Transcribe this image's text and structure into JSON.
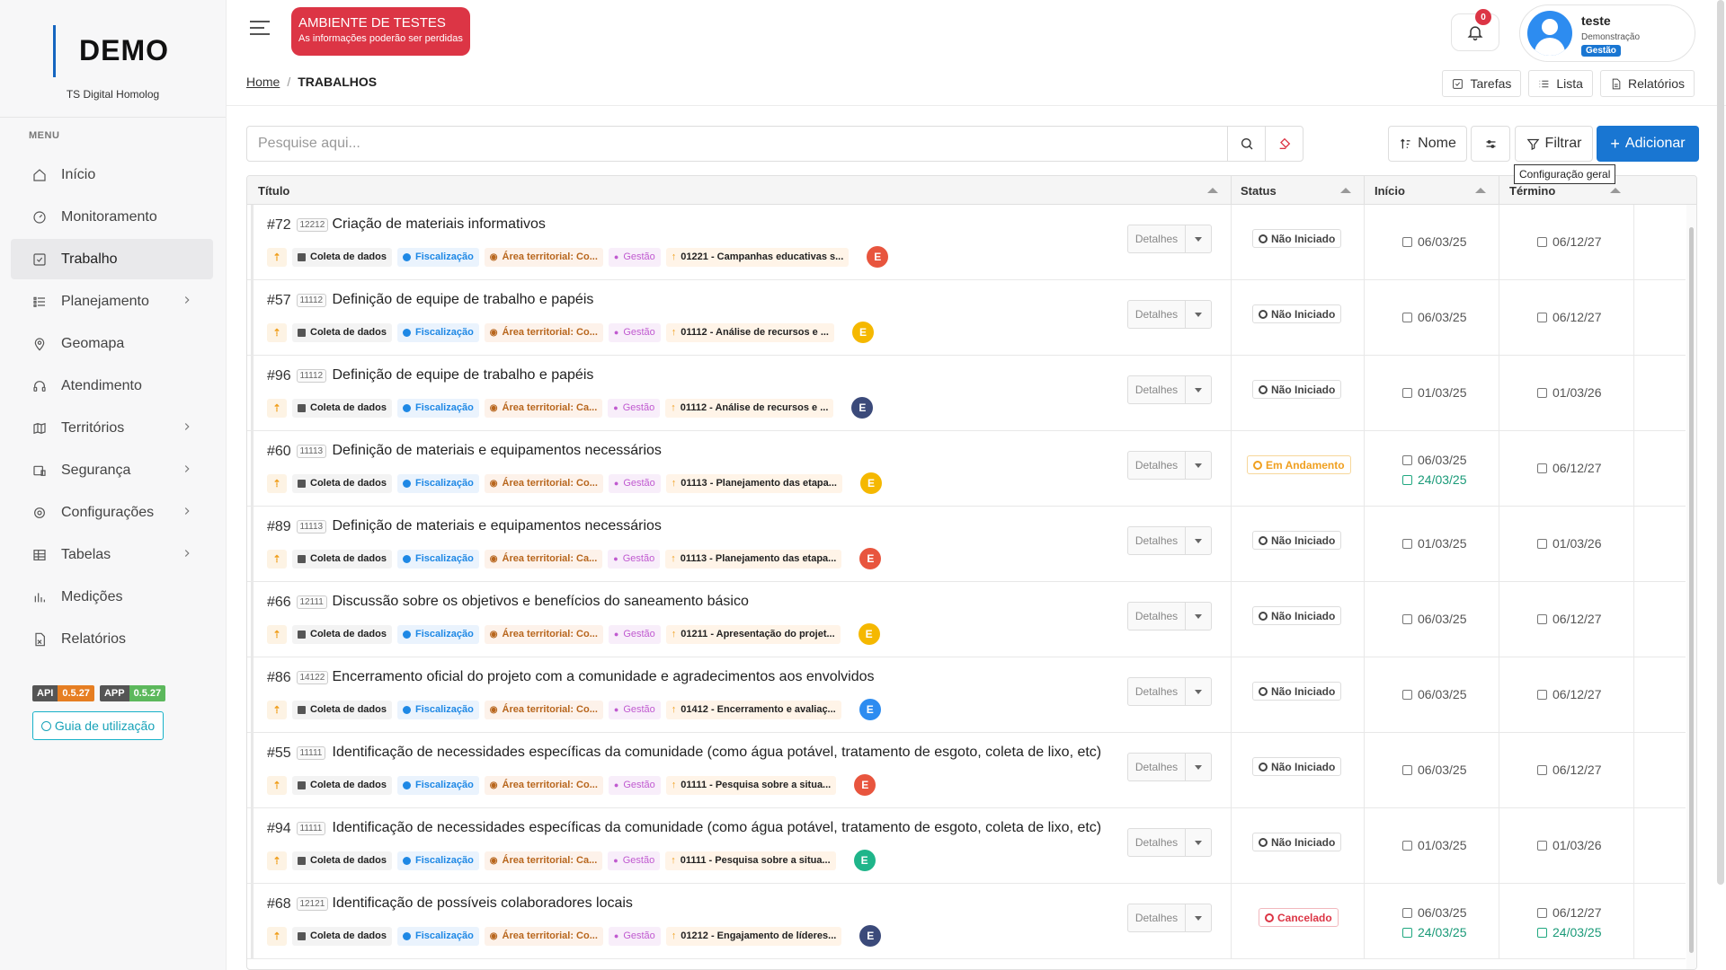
{
  "brand": {
    "title": "DEMO",
    "subtitle": "TS Digital Homolog",
    "accent": "#1565c0"
  },
  "menu": {
    "label": "MENU",
    "items": [
      {
        "label": "Início",
        "icon": "home-icon",
        "chevron": false,
        "active": false
      },
      {
        "label": "Monitoramento",
        "icon": "gauge-icon",
        "chevron": false,
        "active": false
      },
      {
        "label": "Trabalho",
        "icon": "checkbox-icon",
        "chevron": false,
        "active": true
      },
      {
        "label": "Planejamento",
        "icon": "list-icon",
        "chevron": true,
        "active": false
      },
      {
        "label": "Geomapa",
        "icon": "map-pin-icon",
        "chevron": false,
        "active": false
      },
      {
        "label": "Atendimento",
        "icon": "headset-icon",
        "chevron": false,
        "active": false
      },
      {
        "label": "Territórios",
        "icon": "map-icon",
        "chevron": true,
        "active": false
      },
      {
        "label": "Segurança",
        "icon": "shield-icon",
        "chevron": true,
        "active": false
      },
      {
        "label": "Configurações",
        "icon": "gear-icon",
        "chevron": true,
        "active": false
      },
      {
        "label": "Tabelas",
        "icon": "table-icon",
        "chevron": true,
        "active": false
      },
      {
        "label": "Medições",
        "icon": "bar-chart-icon",
        "chevron": false,
        "active": false
      },
      {
        "label": "Relatórios",
        "icon": "report-icon",
        "chevron": false,
        "active": false
      }
    ]
  },
  "versions": {
    "api_label": "API",
    "api_version": "0.5.27",
    "app_label": "APP",
    "app_version": "0.5.27"
  },
  "guide_label": "Guia de utilização",
  "env": {
    "title": "AMBIENTE DE TESTES",
    "subtitle": "As informações poderão ser perdidas",
    "color": "#dc3545"
  },
  "breadcrumb": {
    "home": "Home",
    "separator": "/",
    "current": "TRABALHOS"
  },
  "notifications": {
    "count": "0"
  },
  "user": {
    "name": "teste",
    "role": "Demonstração",
    "tag": "Gestão"
  },
  "top_actions": {
    "tasks": "Tarefas",
    "list": "Lista",
    "reports": "Relatórios"
  },
  "search": {
    "placeholder": "Pesquise aqui..."
  },
  "toolbar": {
    "sort_label": "Nome",
    "filter_label": "Filtrar",
    "add_label": "Adicionar",
    "tooltip": "Configuração geral"
  },
  "table": {
    "columns": {
      "title": "Título",
      "status": "Status",
      "start": "Início",
      "end": "Término"
    },
    "details_label": "Detalhes",
    "tag_collect": "Coleta de dados",
    "tag_fisc": "Fiscalização",
    "tag_gestao": "Gestão",
    "rows": [
      {
        "num": "#72",
        "code": "12212",
        "title": "Criação de materiais informativos",
        "area": "Área territorial: Co...",
        "camp": "01221 - Campanhas educativas s...",
        "avatar": "E",
        "avatar_color": "#e8553e",
        "status": "Não Iniciado",
        "status_kind": "ni",
        "start": "06/03/25",
        "start2": "",
        "end": "06/12/27",
        "end2": ""
      },
      {
        "num": "#57",
        "code": "11112",
        "title": "Definição de equipe de trabalho e papéis",
        "area": "Área territorial: Co...",
        "camp": "01112 - Análise de recursos e ...",
        "avatar": "E",
        "avatar_color": "#f5b800",
        "status": "Não Iniciado",
        "status_kind": "ni",
        "start": "06/03/25",
        "start2": "",
        "end": "06/12/27",
        "end2": ""
      },
      {
        "num": "#96",
        "code": "11112",
        "title": "Definição de equipe de trabalho e papéis",
        "area": "Área territorial: Ca...",
        "camp": "01112 - Análise de recursos e ...",
        "avatar": "E",
        "avatar_color": "#3b4a7a",
        "status": "Não Iniciado",
        "status_kind": "ni",
        "start": "01/03/25",
        "start2": "",
        "end": "01/03/26",
        "end2": ""
      },
      {
        "num": "#60",
        "code": "11113",
        "title": "Definição de materiais e equipamentos necessários",
        "area": "Área territorial: Co...",
        "camp": "01113 - Planejamento das etapa...",
        "avatar": "E",
        "avatar_color": "#f5b800",
        "status": "Em Andamento",
        "status_kind": "ea",
        "start": "06/03/25",
        "start2": "24/03/25",
        "end": "06/12/27",
        "end2": ""
      },
      {
        "num": "#89",
        "code": "11113",
        "title": "Definição de materiais e equipamentos necessários",
        "area": "Área territorial: Ca...",
        "camp": "01113 - Planejamento das etapa...",
        "avatar": "E",
        "avatar_color": "#e8553e",
        "status": "Não Iniciado",
        "status_kind": "ni",
        "start": "01/03/25",
        "start2": "",
        "end": "01/03/26",
        "end2": ""
      },
      {
        "num": "#66",
        "code": "12111",
        "title": "Discussão sobre os objetivos e benefícios do saneamento básico",
        "area": "Área territorial: Co...",
        "camp": "01211 - Apresentação do projet...",
        "avatar": "E",
        "avatar_color": "#f5b800",
        "status": "Não Iniciado",
        "status_kind": "ni",
        "start": "06/03/25",
        "start2": "",
        "end": "06/12/27",
        "end2": ""
      },
      {
        "num": "#86",
        "code": "14122",
        "title": "Encerramento oficial do projeto com a comunidade e agradecimentos aos envolvidos",
        "area": "Área territorial: Co...",
        "camp": "01412 - Encerramento e avaliaç...",
        "avatar": "E",
        "avatar_color": "#2d8cf0",
        "status": "Não Iniciado",
        "status_kind": "ni",
        "start": "06/03/25",
        "start2": "",
        "end": "06/12/27",
        "end2": ""
      },
      {
        "num": "#55",
        "code": "11111",
        "title": "Identificação de necessidades específicas da comunidade (como água potável, tratamento de esgoto, coleta de lixo, etc)",
        "area": "Área territorial: Co...",
        "camp": "01111 - Pesquisa sobre a situa...",
        "avatar": "E",
        "avatar_color": "#e8553e",
        "status": "Não Iniciado",
        "status_kind": "ni",
        "start": "06/03/25",
        "start2": "",
        "end": "06/12/27",
        "end2": ""
      },
      {
        "num": "#94",
        "code": "11111",
        "title": "Identificação de necessidades específicas da comunidade (como água potável, tratamento de esgoto, coleta de lixo, etc)",
        "area": "Área territorial: Ca...",
        "camp": "01111 - Pesquisa sobre a situa...",
        "avatar": "E",
        "avatar_color": "#1fb58a",
        "status": "Não Iniciado",
        "status_kind": "ni",
        "start": "01/03/25",
        "start2": "",
        "end": "01/03/26",
        "end2": ""
      },
      {
        "num": "#68",
        "code": "12121",
        "title": "Identificação de possíveis colaboradores locais",
        "area": "Área territorial: Co...",
        "camp": "01212 - Engajamento de líderes...",
        "avatar": "E",
        "avatar_color": "#3b4a7a",
        "status": "Cancelado",
        "status_kind": "ca",
        "start": "06/03/25",
        "start2": "24/03/25",
        "end": "06/12/27",
        "end2": "24/03/25"
      }
    ]
  }
}
